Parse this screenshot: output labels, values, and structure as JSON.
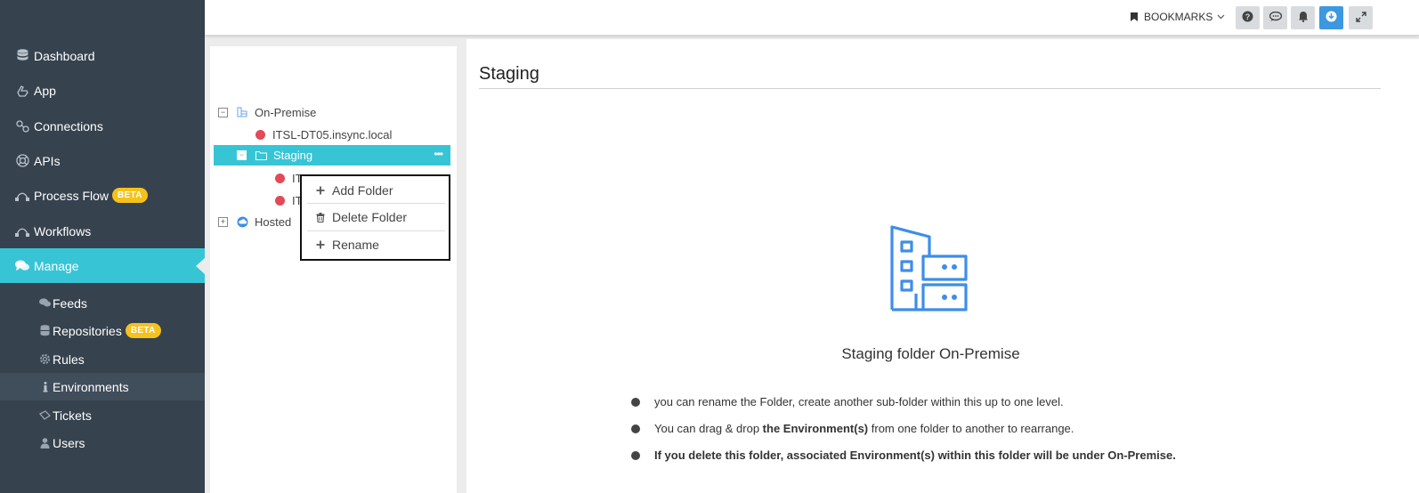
{
  "sidebar": {
    "items": [
      {
        "label": "Dashboard",
        "icon": "database-icon"
      },
      {
        "label": "App",
        "icon": "hand-icon"
      },
      {
        "label": "Connections",
        "icon": "link-icon"
      },
      {
        "label": "APIs",
        "icon": "life-ring-icon"
      },
      {
        "label": "Process Flow",
        "icon": "flow-icon",
        "badge": "BETA"
      },
      {
        "label": "Workflows",
        "icon": "flow-icon"
      },
      {
        "label": "Manage",
        "icon": "comments-icon",
        "active": true
      }
    ],
    "sub_items": [
      {
        "label": "Feeds",
        "icon": "comments-icon"
      },
      {
        "label": "Repositories",
        "icon": "database-icon",
        "badge": "BETA"
      },
      {
        "label": "Rules",
        "icon": "gear-icon"
      },
      {
        "label": "Environments",
        "icon": "info-icon",
        "active": true
      },
      {
        "label": "Tickets",
        "icon": "ticket-icon"
      },
      {
        "label": "Users",
        "icon": "user-icon"
      }
    ]
  },
  "topbar": {
    "bookmarks_label": "BOOKMARKS",
    "buttons": [
      "help-icon",
      "chat-icon",
      "bell-icon",
      "download-icon",
      "expand-icon"
    ]
  },
  "tree": {
    "on_premise": "On-Premise",
    "env1": "ITSL-DT05.insync.local",
    "staging": "Staging",
    "child1_partial": "ITSL-D",
    "child2_partial": "IT",
    "hosted": "Hosted"
  },
  "context_menu": {
    "add_folder": "Add Folder",
    "delete_folder": "Delete Folder",
    "rename": "Rename"
  },
  "content": {
    "title": "Staging",
    "folder_caption": "Staging folder On-Premise",
    "bullet1": "you can rename the Folder, create another sub-folder within this up to one level.",
    "bullet2_pre": "You can drag & drop ",
    "bullet2_bold": "the Environment(s)",
    "bullet2_post": " from one folder to another to rearrange.",
    "bullet3": "If you delete this folder, associated Environment(s) within this folder will be under On-Premise."
  },
  "colors": {
    "sidebar_bg": "#36424e",
    "accent": "#37c5d6",
    "badge": "#f5c21b",
    "env_status_red": "#e24a57",
    "illustration_blue": "#3d8ee8"
  }
}
